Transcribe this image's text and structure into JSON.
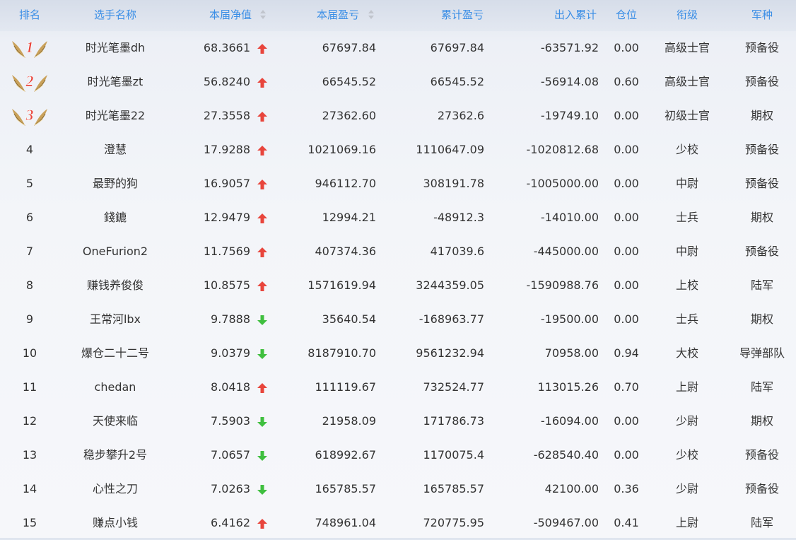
{
  "colors": {
    "header_text": "#3a8ee6",
    "up": "#e8453c",
    "down": "#3fbf3f",
    "medal": "#e8453c",
    "wing": "#c9a15a"
  },
  "header": {
    "rank": "排名",
    "name": "选手名称",
    "net_value": "本届净值",
    "season_pnl": "本届盈亏",
    "total_pnl": "累计盈亏",
    "inout_total": "出入累计",
    "position": "仓位",
    "title": "衔级",
    "branch": "军种"
  },
  "rows": [
    {
      "rank": "1",
      "medal": true,
      "name": "时光笔墨dh",
      "net": "68.3661",
      "trend": "up",
      "season": "67697.84",
      "total": "67697.84",
      "inout": "-63571.92",
      "pos": "0.00",
      "title": "高级士官",
      "branch": "预备役"
    },
    {
      "rank": "2",
      "medal": true,
      "name": "时光笔墨zt",
      "net": "56.8240",
      "trend": "up",
      "season": "66545.52",
      "total": "66545.52",
      "inout": "-56914.08",
      "pos": "0.60",
      "title": "高级士官",
      "branch": "预备役"
    },
    {
      "rank": "3",
      "medal": true,
      "name": "时光笔墨22",
      "net": "27.3558",
      "trend": "up",
      "season": "27362.60",
      "total": "27362.6",
      "inout": "-19749.10",
      "pos": "0.00",
      "title": "初级士官",
      "branch": "期权"
    },
    {
      "rank": "4",
      "medal": false,
      "name": "澄慧",
      "net": "17.9288",
      "trend": "up",
      "season": "1021069.16",
      "total": "1110647.09",
      "inout": "-1020812.68",
      "pos": "0.00",
      "title": "少校",
      "branch": "预备役"
    },
    {
      "rank": "5",
      "medal": false,
      "name": "最野的狗",
      "net": "16.9057",
      "trend": "up",
      "season": "946112.70",
      "total": "308191.78",
      "inout": "-1005000.00",
      "pos": "0.00",
      "title": "中尉",
      "branch": "预备役"
    },
    {
      "rank": "6",
      "medal": false,
      "name": "錢鏕",
      "net": "12.9479",
      "trend": "up",
      "season": "12994.21",
      "total": "-48912.3",
      "inout": "-14010.00",
      "pos": "0.00",
      "title": "士兵",
      "branch": "期权"
    },
    {
      "rank": "7",
      "medal": false,
      "name": "OneFurion2",
      "net": "11.7569",
      "trend": "up",
      "season": "407374.36",
      "total": "417039.6",
      "inout": "-445000.00",
      "pos": "0.00",
      "title": "中尉",
      "branch": "预备役"
    },
    {
      "rank": "8",
      "medal": false,
      "name": "赚钱养俊俊",
      "net": "10.8575",
      "trend": "up",
      "season": "1571619.94",
      "total": "3244359.05",
      "inout": "-1590988.76",
      "pos": "0.00",
      "title": "上校",
      "branch": "陆军"
    },
    {
      "rank": "9",
      "medal": false,
      "name": "王常河lbx",
      "net": "9.7888",
      "trend": "down",
      "season": "35640.54",
      "total": "-168963.77",
      "inout": "-19500.00",
      "pos": "0.00",
      "title": "士兵",
      "branch": "期权"
    },
    {
      "rank": "10",
      "medal": false,
      "name": "爆仓二十二号",
      "net": "9.0379",
      "trend": "down",
      "season": "8187910.70",
      "total": "9561232.94",
      "inout": "70958.00",
      "pos": "0.94",
      "title": "大校",
      "branch": "导弹部队"
    },
    {
      "rank": "11",
      "medal": false,
      "name": "chedan",
      "net": "8.0418",
      "trend": "up",
      "season": "111119.67",
      "total": "732524.77",
      "inout": "113015.26",
      "pos": "0.70",
      "title": "上尉",
      "branch": "陆军"
    },
    {
      "rank": "12",
      "medal": false,
      "name": "天使来临",
      "net": "7.5903",
      "trend": "down",
      "season": "21958.09",
      "total": "171786.73",
      "inout": "-16094.00",
      "pos": "0.00",
      "title": "少尉",
      "branch": "期权"
    },
    {
      "rank": "13",
      "medal": false,
      "name": "稳步攀升2号",
      "net": "7.0657",
      "trend": "down",
      "season": "618992.67",
      "total": "1170075.4",
      "inout": "-628540.40",
      "pos": "0.00",
      "title": "少校",
      "branch": "预备役"
    },
    {
      "rank": "14",
      "medal": false,
      "name": "心性之刀",
      "net": "7.0263",
      "trend": "down",
      "season": "165785.57",
      "total": "165785.57",
      "inout": "42100.00",
      "pos": "0.36",
      "title": "少尉",
      "branch": "预备役"
    },
    {
      "rank": "15",
      "medal": false,
      "name": "赚点小钱",
      "net": "6.4162",
      "trend": "up",
      "season": "748961.04",
      "total": "720775.95",
      "inout": "-509467.00",
      "pos": "0.41",
      "title": "上尉",
      "branch": "陆军"
    }
  ]
}
